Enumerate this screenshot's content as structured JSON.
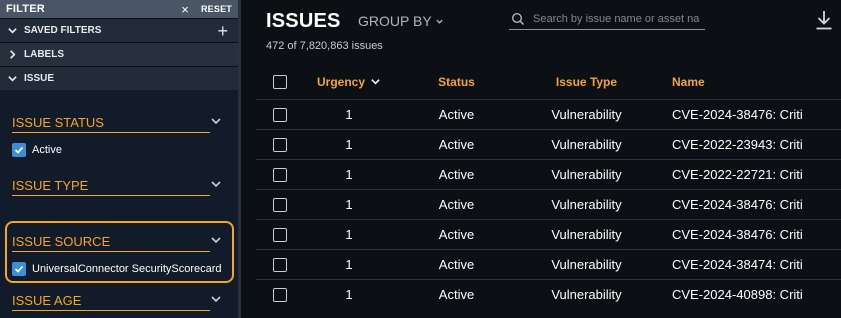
{
  "sidebar": {
    "title": "FILTER",
    "close_glyph": "×",
    "reset": "RESET",
    "sections": {
      "saved_filters": "SAVED FILTERS",
      "labels": "LABELS",
      "issue": "ISSUE"
    },
    "add_glyph": "+",
    "groups": {
      "status": {
        "title": "ISSUE STATUS",
        "options": [
          "Active"
        ]
      },
      "type": {
        "title": "ISSUE TYPE"
      },
      "source": {
        "title": "ISSUE SOURCE",
        "options": [
          "UniversalConnector SecurityScorecard"
        ]
      },
      "age": {
        "title": "ISSUE AGE"
      }
    }
  },
  "main": {
    "title": "ISSUES",
    "group_by": "GROUP BY",
    "count": "472 of 7,820,863 issues",
    "search_placeholder": "Search by issue name or asset na",
    "columns": {
      "urgency": "Urgency",
      "status": "Status",
      "type": "Issue Type",
      "name": "Name"
    },
    "rows": [
      {
        "urgency": "1",
        "status": "Active",
        "type": "Vulnerability",
        "name": "CVE-2024-38476: Criti"
      },
      {
        "urgency": "1",
        "status": "Active",
        "type": "Vulnerability",
        "name": "CVE-2022-23943: Criti"
      },
      {
        "urgency": "1",
        "status": "Active",
        "type": "Vulnerability",
        "name": "CVE-2022-22721: Criti"
      },
      {
        "urgency": "1",
        "status": "Active",
        "type": "Vulnerability",
        "name": "CVE-2024-38476: Criti"
      },
      {
        "urgency": "1",
        "status": "Active",
        "type": "Vulnerability",
        "name": "CVE-2024-38476: Criti"
      },
      {
        "urgency": "1",
        "status": "Active",
        "type": "Vulnerability",
        "name": "CVE-2024-38474: Criti"
      },
      {
        "urgency": "1",
        "status": "Active",
        "type": "Vulnerability",
        "name": "CVE-2024-40898: Criti"
      }
    ]
  },
  "colors": {
    "accent": "#f5a623",
    "checkbox": "#3b8fd6",
    "background": "#0c0f14",
    "sidebar": "#121b2a"
  }
}
